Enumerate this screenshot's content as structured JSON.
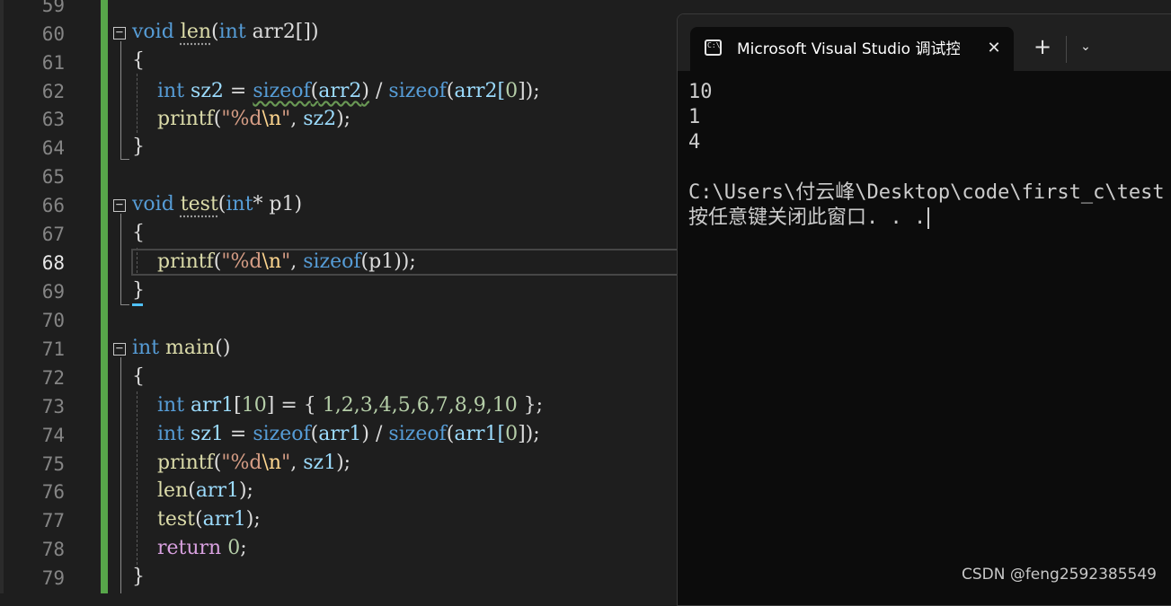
{
  "editor": {
    "line_numbers": [
      "59",
      "60",
      "61",
      "62",
      "63",
      "64",
      "65",
      "66",
      "67",
      "68",
      "69",
      "70",
      "71",
      "72",
      "73",
      "74",
      "75",
      "76",
      "77",
      "78",
      "79"
    ],
    "current_line": "68",
    "code": {
      "l60": {
        "void": "void",
        "name": "len",
        "open": "(",
        "int": "int",
        "param": " arr2[]",
        "close": ")"
      },
      "l61": {
        "brace": "{"
      },
      "l62": {
        "int": "int",
        "var": "sz2",
        "eq": " = ",
        "sizeof1": "sizeof",
        "p1": "(",
        "a1": "arr2",
        "p2": ")",
        "div": " / ",
        "sizeof2": "sizeof",
        "p3": "(",
        "a2": "arr2[",
        "zero": "0",
        "p4": "]);"
      },
      "l63": {
        "fn": "printf",
        "open": "(",
        "str": "\"%d",
        "esc": "\\n",
        "strend": "\"",
        "comma": ", ",
        "var": "sz2",
        "close": ");"
      },
      "l64": {
        "brace": "}"
      },
      "l66": {
        "void": "void",
        "name": "test",
        "open": "(",
        "int": "int",
        "param": "* p1",
        "close": ")"
      },
      "l67": {
        "brace": "{"
      },
      "l68": {
        "fn": "printf",
        "open": "(",
        "str": "\"%d",
        "esc": "\\n",
        "strend": "\"",
        "comma": ", ",
        "sizeof": "sizeof",
        "rest": "(p1));"
      },
      "l69": {
        "brace": "}"
      },
      "l71": {
        "int": "int",
        "name": "main",
        "parens": "()"
      },
      "l72": {
        "brace": "{"
      },
      "l73": {
        "int": "int",
        "var": "arr1",
        "br1": "[",
        "ten": "10",
        "br2": "] = { ",
        "nums": "1,2,3,4,5,6,7,8,9,10",
        "end": " };"
      },
      "l74": {
        "int": "int",
        "var": "sz1",
        "eq": " = ",
        "sizeof1": "sizeof",
        "p1": "(",
        "a1": "arr1",
        "p2": ")",
        "div": " / ",
        "sizeof2": "sizeof",
        "p3": "(",
        "a2": "arr1[",
        "zero": "0",
        "p4": "]);"
      },
      "l75": {
        "fn": "printf",
        "open": "(",
        "str": "\"%d",
        "esc": "\\n",
        "strend": "\"",
        "comma": ", ",
        "var": "sz1",
        "close": ");"
      },
      "l76": {
        "fn": "len",
        "open": "(",
        "var": "arr1",
        "close": ");"
      },
      "l77": {
        "fn": "test",
        "open": "(",
        "var": "arr1",
        "close": ");"
      },
      "l78": {
        "ret": "return",
        "sp": " ",
        "zero": "0",
        "semi": ";"
      },
      "l79": {
        "brace": "}"
      }
    }
  },
  "terminal": {
    "tab_title": "Microsoft Visual Studio 调试控制台",
    "icon_text": "C:\\",
    "close_icon": "✕",
    "new_tab_icon": "+",
    "dropdown_icon": "⌄",
    "output": [
      "10",
      "1",
      "4",
      "",
      "C:\\Users\\付云峰\\Desktop\\code\\first_c\\test",
      "按任意键关闭此窗口. . ."
    ]
  },
  "watermark": "CSDN @feng2592385549",
  "colors": {
    "editor_bg": "#1e1e1e",
    "terminal_bg": "#0c0c0c",
    "keyword": "#569cd6",
    "function": "#dcdcaa",
    "identifier": "#9cdcfe",
    "string": "#d69d85",
    "number": "#b5cea8",
    "change_bar": "#57a64a"
  }
}
